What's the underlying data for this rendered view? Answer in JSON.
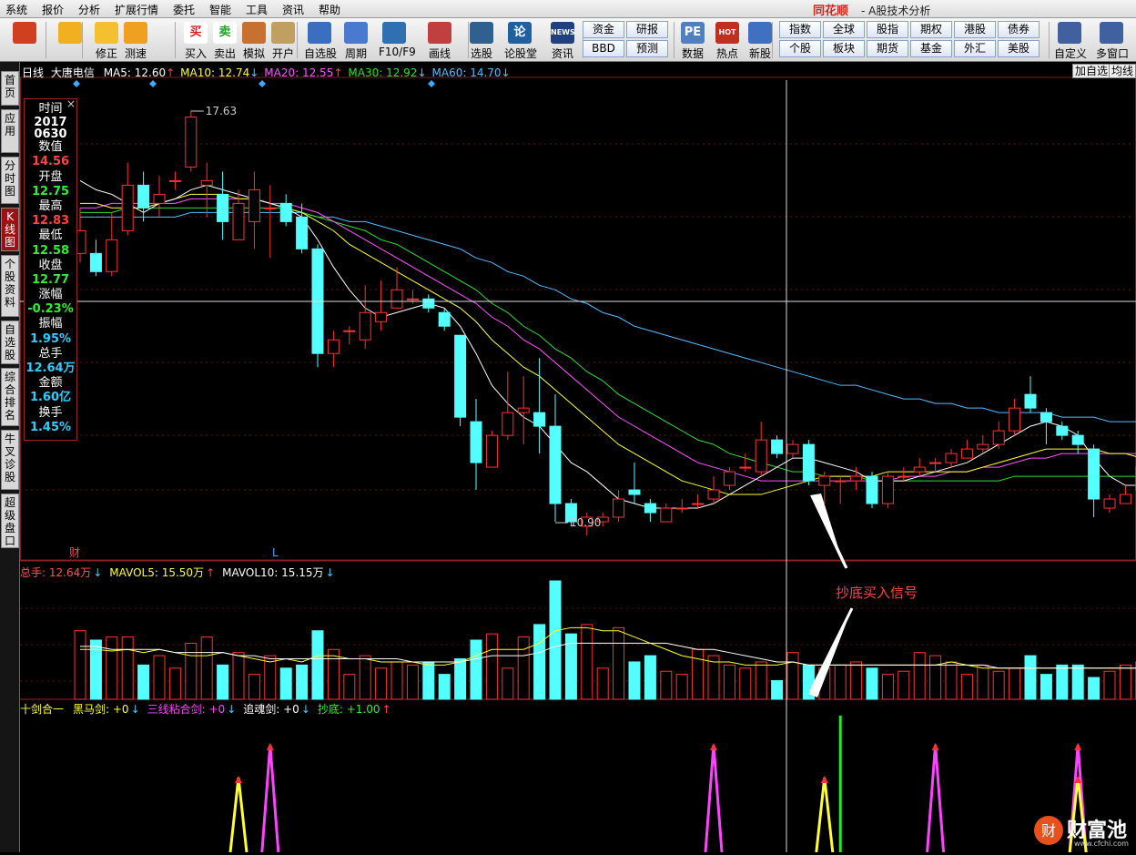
{
  "menu": [
    "系统",
    "报价",
    "分析",
    "扩展行情",
    "委托",
    "智能",
    "工具",
    "资讯",
    "帮助"
  ],
  "brand": "同花顺",
  "window_title": "- A股技术分析",
  "toolbar": [
    {
      "label": "",
      "icon": "windows-logo-icon"
    },
    {
      "label": "",
      "icon": "back-arrow-icon"
    },
    {
      "label": "修正",
      "icon": "up-down-icon"
    },
    {
      "label": "测速",
      "icon": "clock-icon"
    },
    {
      "label": "买入",
      "icon": "buy-icon",
      "glyph": "买"
    },
    {
      "label": "卖出",
      "icon": "sell-icon",
      "glyph": "卖"
    },
    {
      "label": "模拟",
      "icon": "hammer-icon"
    },
    {
      "label": "开户",
      "icon": "lock-icon"
    },
    {
      "label": "自选股",
      "icon": "star-icon"
    },
    {
      "label": "周期",
      "icon": "cycle-icon"
    },
    {
      "label": "F10/F9",
      "icon": "f10-icon"
    },
    {
      "label": "画线",
      "icon": "pen-icon"
    },
    {
      "label": "选股",
      "icon": "screen-icon"
    },
    {
      "label": "论股堂",
      "icon": "chat-icon",
      "glyph": "论"
    },
    {
      "label": "资讯",
      "icon": "news-icon",
      "glyph": "NEWS"
    },
    {
      "label": "数据",
      "icon": "pe-icon",
      "glyph": "PE"
    },
    {
      "label": "热点",
      "icon": "hot-icon",
      "glyph": "HOT"
    },
    {
      "label": "新股",
      "icon": "newstock-icon"
    },
    {
      "label": "自定义",
      "icon": "custom-icon"
    },
    {
      "label": "多窗口",
      "icon": "multiwin-icon"
    }
  ],
  "grid_buttons": [
    "资金",
    "研报",
    "BBD",
    "预测",
    "指数",
    "全球",
    "股指",
    "期权",
    "港股",
    "债券",
    "个股",
    "板块",
    "期货",
    "基金",
    "外汇",
    "美股"
  ],
  "side_tabs": [
    "首页",
    "应用",
    "分时图",
    "K线图",
    "个股资料",
    "自选股",
    "综合排名",
    "牛叉诊股",
    "超级盘口"
  ],
  "side_active": 3,
  "legend": {
    "period": "日线",
    "name": "大唐电信",
    "ma": [
      {
        "t": "MA5: 12.60",
        "a": "↑",
        "c": "#ffffff"
      },
      {
        "t": "MA10: 12.74",
        "a": "↓",
        "c": "#ffff33"
      },
      {
        "t": "MA20: 12.55",
        "a": "↑",
        "c": "#ff55ff"
      },
      {
        "t": "MA30: 12.92",
        "a": "↓",
        "c": "#33dd33"
      },
      {
        "t": "MA60: 14.70",
        "a": "↓",
        "c": "#55bbff"
      }
    ]
  },
  "top_buttons": [
    "加自选",
    "均线"
  ],
  "info": {
    "date1": "2017",
    "date2": "0630",
    "rows": [
      [
        "时间",
        ""
      ],
      [
        "数值",
        "14.56"
      ],
      [
        "开盘",
        "12.75"
      ],
      [
        "最高",
        "12.83"
      ],
      [
        "最低",
        "12.58"
      ],
      [
        "收盘",
        "12.77"
      ],
      [
        "涨幅",
        "-0.23%"
      ],
      [
        "振幅",
        "1.95%"
      ],
      [
        "总手",
        "12.64万"
      ],
      [
        "金额",
        "1.60亿"
      ],
      [
        "换手",
        "1.45%"
      ]
    ]
  },
  "annotations": {
    "max": "17.63",
    "min": "10.90",
    "cai": "财",
    "L": "L",
    "signal": "抄底买入信号"
  },
  "vol_legend": [
    {
      "t": "总手: 12.64万",
      "a": "↓",
      "c": "#ff5555"
    },
    {
      "t": "MAVOL5: 15.50万",
      "a": "↑",
      "c": "#ffff33"
    },
    {
      "t": "MAVOL10: 15.15万",
      "a": "↓",
      "c": "#ffffff"
    }
  ],
  "ind_legend": [
    {
      "t": "十剑合一",
      "a": "",
      "c": "#ffff33"
    },
    {
      "t": "黑马剑: +0",
      "a": "↓",
      "c": "#ffff33"
    },
    {
      "t": "三线粘合剑: +0",
      "a": "↓",
      "c": "#ff44ff"
    },
    {
      "t": "追魂剑: +0",
      "a": "↓",
      "c": "#ffffff"
    },
    {
      "t": "抄底: +1.00",
      "a": "↑",
      "c": "#33ee33"
    }
  ],
  "watermark": {
    "title": "财富池",
    "url": "www.cfchi.com"
  },
  "chart_data": {
    "type": "candlestick",
    "up_color": "#ff3333",
    "down_color": "#54ffff",
    "max_price": 17.63,
    "min_price": 10.9,
    "candles": [
      [
        14.5,
        15.0,
        15.5,
        14.3
      ],
      [
        14.5,
        14.1,
        14.8,
        14.0
      ],
      [
        14.1,
        14.8,
        15.4,
        14.0
      ],
      [
        15.0,
        16.0,
        16.5,
        14.9
      ],
      [
        16.0,
        15.5,
        16.3,
        15.2
      ],
      [
        15.6,
        15.8,
        16.2,
        15.3
      ],
      [
        16.1,
        16.1,
        16.3,
        15.9
      ],
      [
        16.4,
        17.5,
        17.63,
        16.3
      ],
      [
        16.0,
        16.1,
        16.5,
        15.3
      ],
      [
        15.8,
        15.2,
        16.3,
        14.8
      ],
      [
        14.8,
        15.6,
        15.9,
        14.8
      ],
      [
        15.2,
        15.9,
        16.3,
        14.6
      ],
      [
        15.5,
        15.5,
        16.0,
        14.4
      ],
      [
        15.6,
        15.2,
        15.8,
        15.1
      ],
      [
        15.3,
        14.6,
        15.6,
        14.5
      ],
      [
        14.6,
        12.3,
        14.7,
        12.0
      ],
      [
        12.3,
        12.6,
        12.8,
        12.0
      ],
      [
        12.8,
        12.8,
        12.9,
        12.5
      ],
      [
        12.6,
        13.2,
        13.8,
        12.4
      ],
      [
        13.0,
        13.2,
        13.9,
        12.8
      ],
      [
        13.3,
        13.7,
        14.2,
        13.3
      ],
      [
        13.5,
        13.5,
        13.7,
        13.4
      ],
      [
        13.5,
        13.3,
        13.6,
        13.2
      ],
      [
        13.2,
        12.9,
        13.3,
        12.8
      ],
      [
        12.7,
        10.9,
        12.7,
        10.7
      ],
      [
        10.8,
        9.9,
        11.3,
        9.3
      ],
      [
        9.8,
        10.5,
        10.6,
        9.9
      ],
      [
        10.5,
        11.0,
        11.9,
        10.4
      ],
      [
        11.0,
        11.1,
        11.8,
        10.3
      ],
      [
        11.0,
        10.7,
        12.2,
        10.1
      ],
      [
        10.7,
        9.0,
        11.4,
        8.6
      ],
      [
        9.0,
        8.6,
        9.1,
        8.5
      ],
      [
        8.5,
        8.7,
        8.8,
        8.3
      ],
      [
        8.6,
        8.7,
        8.8,
        8.5
      ],
      [
        8.7,
        9.1,
        9.3,
        8.6
      ],
      [
        9.3,
        9.2,
        9.9,
        9.0
      ],
      [
        9.0,
        8.8,
        9.1,
        8.6
      ],
      [
        8.6,
        8.9,
        9.0,
        8.6
      ],
      [
        8.9,
        8.9,
        9.1,
        8.8
      ],
      [
        9.0,
        9.0,
        9.2,
        8.9
      ],
      [
        9.1,
        9.3,
        9.6,
        9.0
      ],
      [
        9.4,
        9.7,
        9.8,
        9.3
      ],
      [
        9.8,
        9.8,
        10.1,
        9.7
      ],
      [
        9.7,
        10.4,
        10.8,
        9.6
      ],
      [
        10.4,
        10.1,
        10.5,
        10.0
      ],
      [
        10.1,
        10.3,
        10.4,
        10.0
      ],
      [
        10.3,
        9.5,
        10.4,
        9.4
      ],
      [
        9.4,
        9.6,
        9.7,
        9.0
      ],
      [
        9.5,
        9.5,
        9.6,
        9.0
      ],
      [
        9.5,
        9.6,
        9.8,
        9.3
      ],
      [
        9.6,
        9.0,
        9.7,
        8.9
      ],
      [
        9.0,
        9.6,
        9.7,
        8.9
      ],
      [
        9.6,
        9.6,
        9.8,
        9.5
      ],
      [
        9.7,
        9.8,
        10.0,
        9.6
      ],
      [
        9.9,
        9.9,
        10.0,
        9.7
      ],
      [
        9.9,
        10.1,
        10.2,
        9.8
      ],
      [
        10.0,
        10.2,
        10.4,
        10.0
      ],
      [
        10.2,
        10.3,
        10.5,
        10.1
      ],
      [
        10.3,
        10.6,
        10.8,
        10.2
      ],
      [
        10.6,
        11.1,
        11.3,
        10.5
      ],
      [
        11.4,
        11.1,
        11.8,
        11.0
      ],
      [
        11.0,
        10.8,
        11.1,
        10.3
      ],
      [
        10.7,
        10.5,
        10.8,
        10.4
      ],
      [
        10.5,
        10.3,
        10.6,
        10.1
      ],
      [
        10.2,
        9.1,
        10.3,
        8.7
      ],
      [
        8.9,
        9.1,
        9.2,
        8.8
      ],
      [
        9.0,
        9.2,
        9.4,
        9.0
      ],
      [
        9.3,
        9.8,
        9.9,
        9.2
      ],
      [
        9.7,
        10.9,
        11.3,
        9.6
      ],
      [
        11.0,
        10.8,
        11.3,
        10.7
      ],
      [
        10.7,
        10.8,
        11.2,
        10.5
      ],
      [
        10.8,
        10.9,
        11.1,
        10.7
      ],
      [
        10.9,
        11.2,
        11.3,
        10.8
      ],
      [
        11.1,
        11.0,
        11.2,
        10.8
      ],
      [
        11.0,
        10.9,
        11.1,
        10.8
      ],
      [
        11.0,
        11.1,
        11.2,
        10.8
      ]
    ],
    "ma5": [
      16.1,
      15.9,
      15.8,
      15.6,
      15.4,
      15.6,
      15.7,
      15.9,
      16.0,
      15.9,
      15.8,
      15.7,
      15.6,
      15.5,
      15.3,
      14.8,
      14.2,
      13.7,
      13.3,
      13.1,
      13.2,
      13.3,
      13.4,
      13.3,
      12.9,
      12.3,
      11.6,
      11.2,
      10.9,
      10.7,
      10.3,
      9.9,
      9.7,
      9.4,
      9.1,
      9.0,
      8.9,
      8.9,
      8.9,
      8.9,
      9.0,
      9.2,
      9.4,
      9.6,
      9.8,
      10.0,
      10.0,
      9.9,
      9.8,
      9.7,
      9.5,
      9.5,
      9.5,
      9.6,
      9.7,
      9.8,
      9.9,
      10.1,
      10.3,
      10.5,
      10.7,
      10.8,
      10.7,
      10.5,
      10.0,
      9.6,
      9.4,
      9.4,
      9.6,
      10.0,
      10.4,
      10.6,
      10.8,
      10.9,
      10.9,
      10.9
    ],
    "ma10": [
      15.6,
      15.6,
      15.5,
      15.5,
      15.5,
      15.6,
      15.7,
      15.8,
      15.8,
      15.8,
      15.7,
      15.7,
      15.6,
      15.5,
      15.4,
      15.2,
      15.0,
      14.7,
      14.5,
      14.3,
      14.1,
      13.9,
      13.7,
      13.5,
      13.3,
      13.0,
      12.6,
      12.3,
      12.0,
      11.8,
      11.5,
      11.2,
      10.9,
      10.6,
      10.3,
      10.1,
      9.9,
      9.7,
      9.5,
      9.4,
      9.3,
      9.2,
      9.2,
      9.2,
      9.3,
      9.4,
      9.5,
      9.6,
      9.6,
      9.6,
      9.6,
      9.7,
      9.7,
      9.7,
      9.7,
      9.7,
      9.7,
      9.8,
      9.9,
      10.0,
      10.1,
      10.2,
      10.2,
      10.2,
      10.2,
      10.1,
      10.1,
      10.0,
      10.0,
      10.0,
      10.1,
      10.1,
      10.2,
      10.3,
      10.4,
      10.5
    ],
    "ma20": [
      15.5,
      15.5,
      15.6,
      15.6,
      15.6,
      15.6,
      15.6,
      15.7,
      15.7,
      15.7,
      15.7,
      15.7,
      15.6,
      15.6,
      15.5,
      15.4,
      15.2,
      15.0,
      14.8,
      14.6,
      14.4,
      14.2,
      14.0,
      13.8,
      13.6,
      13.4,
      13.1,
      12.9,
      12.6,
      12.4,
      12.1,
      11.8,
      11.5,
      11.2,
      10.9,
      10.7,
      10.5,
      10.3,
      10.1,
      9.9,
      9.8,
      9.7,
      9.6,
      9.5,
      9.5,
      9.5,
      9.5,
      9.5,
      9.5,
      9.5,
      9.5,
      9.5,
      9.6,
      9.6,
      9.6,
      9.7,
      9.7,
      9.8,
      9.8,
      9.9,
      10.0,
      10.0,
      10.1,
      10.1,
      10.1,
      10.1,
      10.1,
      10.1,
      10.1,
      10.2,
      10.2,
      10.2,
      10.3,
      10.3,
      10.3,
      10.4
    ],
    "ma30": [
      15.4,
      15.4,
      15.4,
      15.5,
      15.5,
      15.5,
      15.5,
      15.5,
      15.5,
      15.5,
      15.5,
      15.5,
      15.5,
      15.5,
      15.4,
      15.3,
      15.2,
      15.1,
      15.0,
      14.8,
      14.7,
      14.5,
      14.3,
      14.1,
      13.9,
      13.7,
      13.4,
      13.2,
      12.9,
      12.7,
      12.4,
      12.2,
      11.9,
      11.7,
      11.4,
      11.2,
      11.0,
      10.8,
      10.6,
      10.4,
      10.3,
      10.1,
      10.0,
      9.9,
      9.8,
      9.7,
      9.7,
      9.6,
      9.6,
      9.6,
      9.5,
      9.5,
      9.5,
      9.5,
      9.5,
      9.5,
      9.5,
      9.5,
      9.5,
      9.6,
      9.6,
      9.6,
      9.6,
      9.6,
      9.6,
      9.6,
      9.6,
      9.6,
      9.6,
      9.6,
      9.6,
      9.6,
      9.7,
      9.7,
      9.7,
      9.7
    ],
    "ma60": [
      15.3,
      15.3,
      15.3,
      15.3,
      15.3,
      15.3,
      15.3,
      15.4,
      15.4,
      15.4,
      15.4,
      15.4,
      15.4,
      15.4,
      15.4,
      15.3,
      15.3,
      15.2,
      15.2,
      15.1,
      15.0,
      14.9,
      14.8,
      14.7,
      14.6,
      14.4,
      14.3,
      14.1,
      14.0,
      13.8,
      13.7,
      13.5,
      13.4,
      13.2,
      13.1,
      12.9,
      12.8,
      12.7,
      12.6,
      12.5,
      12.4,
      12.3,
      12.2,
      12.1,
      12.0,
      11.9,
      11.8,
      11.7,
      11.6,
      11.6,
      11.5,
      11.4,
      11.3,
      11.3,
      11.2,
      11.2,
      11.1,
      11.1,
      11.0,
      11.0,
      11.0,
      11.0,
      10.9,
      10.9,
      10.9,
      10.8,
      10.8,
      10.8,
      10.7,
      10.7,
      10.7,
      10.7,
      10.6,
      10.6,
      10.6,
      10.6
    ],
    "volume": [
      22,
      19,
      20,
      20,
      11,
      14,
      10,
      18,
      20,
      11,
      15,
      8,
      14,
      10,
      11,
      22,
      16,
      8,
      14,
      10,
      12,
      11,
      12,
      8,
      13,
      19,
      21,
      10,
      20,
      24,
      38,
      21,
      24,
      10,
      23,
      12,
      14,
      9,
      8,
      16,
      14,
      11,
      10,
      12,
      6,
      15,
      11,
      10,
      11,
      12,
      10,
      8,
      9,
      15,
      14,
      12,
      8,
      11,
      9,
      10,
      14,
      8,
      11,
      11,
      7,
      9,
      11,
      12,
      10,
      11,
      16,
      12,
      10,
      11,
      9,
      13
    ],
    "vol_ma5": [
      16,
      16,
      15.5,
      16,
      15,
      16,
      15,
      14,
      14,
      15,
      14,
      13,
      12,
      13,
      12,
      14,
      14,
      13,
      13,
      12,
      12,
      12,
      11,
      11,
      12,
      14,
      16,
      16,
      16,
      18,
      22,
      23,
      23,
      22,
      22,
      20,
      18,
      16,
      14,
      13,
      12,
      12,
      11,
      11,
      11,
      12,
      11,
      11,
      11,
      11,
      11,
      11,
      11,
      11,
      11,
      12,
      11,
      10,
      10,
      10,
      10,
      10,
      10,
      10,
      10,
      10,
      10,
      10,
      10,
      10,
      11,
      11,
      11,
      11,
      11,
      11
    ],
    "vol_ma10": [
      17,
      17,
      16,
      16,
      16,
      16,
      15,
      15,
      15,
      15,
      14,
      14,
      13,
      13,
      13,
      13,
      13,
      13,
      13,
      13,
      13,
      12,
      12,
      12,
      12,
      13,
      14,
      14,
      14,
      15,
      17,
      18,
      18,
      18,
      18,
      18,
      18,
      18,
      17,
      16,
      16,
      15,
      14,
      13,
      12,
      12,
      11,
      11,
      11,
      11,
      11,
      11,
      11,
      11,
      11,
      11,
      11,
      11,
      10,
      10,
      10,
      10,
      10,
      10,
      10,
      10,
      10,
      10,
      10,
      10,
      10,
      10,
      11,
      11,
      11,
      11
    ],
    "signals": [
      {
        "i": 10,
        "name": "黑马剑",
        "color": "#ffff33",
        "h": 82
      },
      {
        "i": 12,
        "name": "三线粘合剑",
        "color": "#ff44ff",
        "h": 118
      },
      {
        "i": 40,
        "name": "三线粘合剑",
        "color": "#ff44ff",
        "h": 118
      },
      {
        "i": 47,
        "name": "黑马剑",
        "color": "#ffff33",
        "h": 82
      },
      {
        "i": 54,
        "name": "三线粘合剑",
        "color": "#ff44ff",
        "h": 118
      },
      {
        "i": 63,
        "name": "三线粘合剑",
        "color": "#ff44ff",
        "h": 118
      },
      {
        "i": 63,
        "name": "黑马剑",
        "color": "#ffff33",
        "h": 82
      },
      {
        "i": 48,
        "name": "抄底",
        "color": "#22ee22",
        "h": 150
      }
    ]
  }
}
